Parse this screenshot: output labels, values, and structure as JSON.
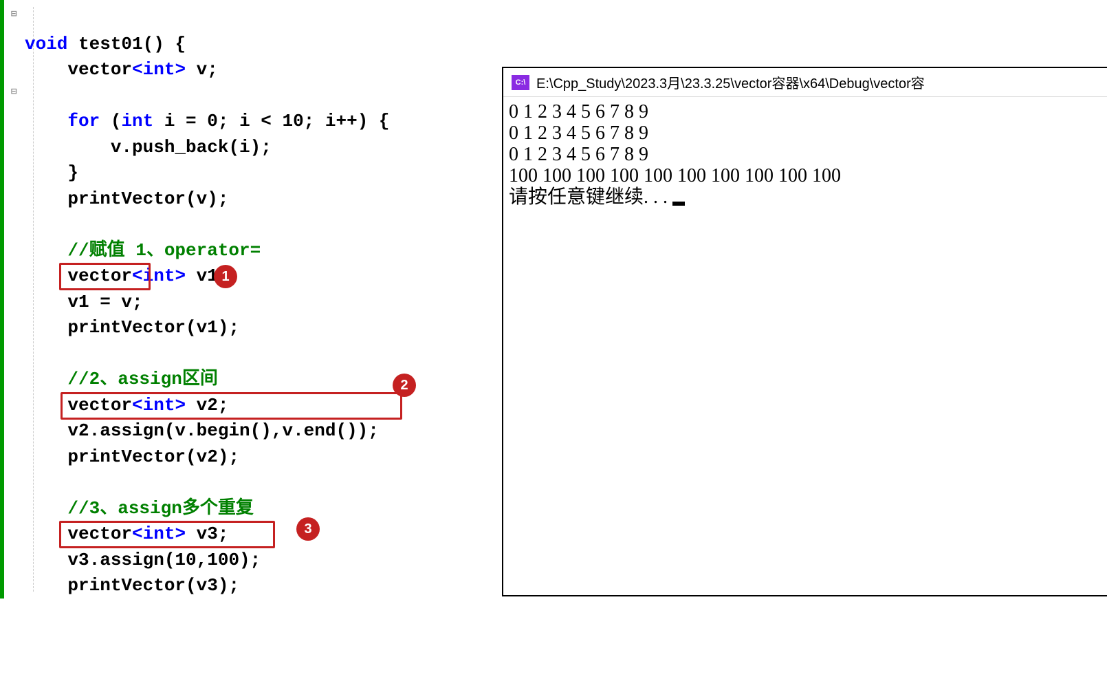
{
  "code": {
    "line1_void": "void",
    "line1_func": " test01() {",
    "line2_vector": "    vector",
    "line2_int": "<int>",
    "line2_rest": " v;",
    "line3": "",
    "line4_for": "    for",
    "line4_open": " (",
    "line4_int": "int",
    "line4_rest": " i = 0; i < 10; i++) {",
    "line5": "        v.push_back(i);",
    "line6": "    }",
    "line7": "    printVector(v);",
    "line8": "",
    "line9_comment": "    //赋值 1、operator=",
    "line10_vector": "    vector",
    "line10_int": "<int>",
    "line10_rest": " v1;",
    "line11": "    v1 = v;",
    "line12": "    printVector(v1);",
    "line13": "",
    "line14_comment": "    //2、assign区间",
    "line15_vector": "    vector",
    "line15_int": "<int>",
    "line15_rest": " v2;",
    "line16": "    v2.assign(v.begin(),v.end());",
    "line17": "    printVector(v2);",
    "line18": "",
    "line19_comment": "    //3、assign多个重复",
    "line20_vector": "    vector",
    "line20_int": "<int>",
    "line20_rest": " v3;",
    "line21": "    v3.assign(10,100);",
    "line22": "    printVector(v3);"
  },
  "badges": {
    "b1": "1",
    "b2": "2",
    "b3": "3"
  },
  "console": {
    "icon_text": "C:\\",
    "title": "E:\\Cpp_Study\\2023.3月\\23.3.25\\vector容器\\x64\\Debug\\vector容",
    "line1": "0 1 2 3 4 5 6 7 8 9",
    "line2": "0 1 2 3 4 5 6 7 8 9",
    "line3": "0 1 2 3 4 5 6 7 8 9",
    "line4": "100 100 100 100 100 100 100 100 100 100",
    "line5": "请按任意键继续. . . "
  }
}
